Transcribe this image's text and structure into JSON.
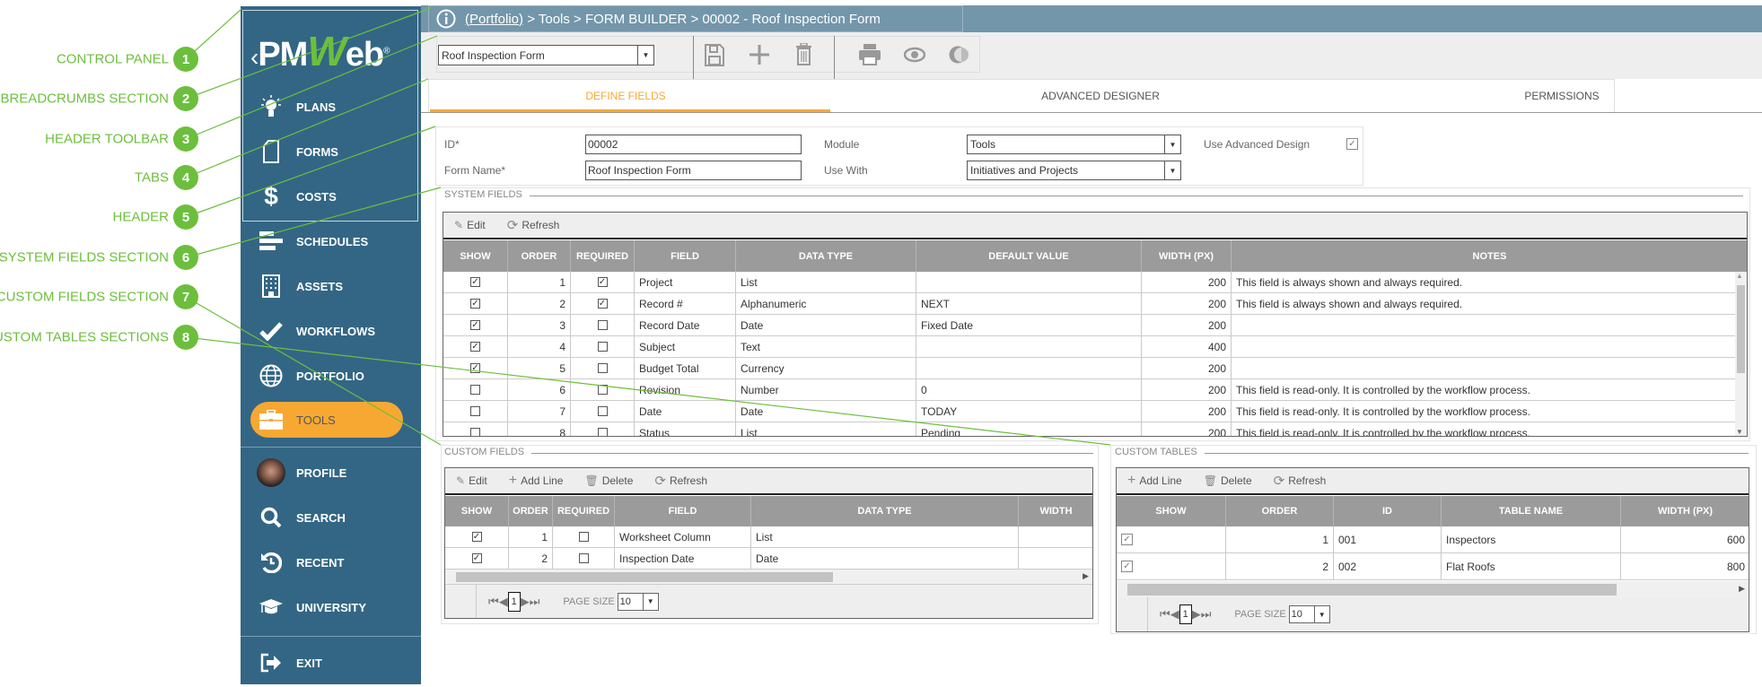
{
  "annotations": [
    {
      "n": "1",
      "label": "CONTROL PANEL"
    },
    {
      "n": "2",
      "label": "BREADCRUMBS SECTION"
    },
    {
      "n": "3",
      "label": "HEADER TOOLBAR"
    },
    {
      "n": "4",
      "label": "TABS"
    },
    {
      "n": "5",
      "label": "HEADER"
    },
    {
      "n": "6",
      "label": "SYSTEM FIELDS SECTION"
    },
    {
      "n": "7",
      "label": "CUSTOM FIELDS SECTION"
    },
    {
      "n": "8",
      "label": "CUSTOM TABLES SECTIONS"
    }
  ],
  "colors": {
    "sidebar": "#336685",
    "breadcrumb": "#7396ab",
    "accent": "#f7a833",
    "annotation": "#6cbf3c",
    "grid_header": "#9b9b9b"
  },
  "sidebar": {
    "logo": {
      "pre": "PM",
      "w": "W",
      "post": "eb",
      "reg": "®",
      "back": "‹"
    },
    "items": [
      {
        "label": "PLANS",
        "icon": "lightbulb-icon"
      },
      {
        "label": "FORMS",
        "icon": "document-icon"
      },
      {
        "label": "COSTS",
        "icon": "dollar-icon"
      },
      {
        "label": "SCHEDULES",
        "icon": "gantt-icon"
      },
      {
        "label": "ASSETS",
        "icon": "building-icon"
      },
      {
        "label": "WORKFLOWS",
        "icon": "checkmark-icon"
      },
      {
        "label": "PORTFOLIO",
        "icon": "globe-icon"
      },
      {
        "label": "TOOLS",
        "icon": "briefcase-icon",
        "active": true
      },
      {
        "label": "PROFILE",
        "icon": "avatar"
      },
      {
        "label": "SEARCH",
        "icon": "search-icon"
      },
      {
        "label": "RECENT",
        "icon": "history-icon"
      },
      {
        "label": "UNIVERSITY",
        "icon": "graduation-cap-icon"
      },
      {
        "label": "EXIT",
        "icon": "exit-icon"
      }
    ]
  },
  "breadcrumb": {
    "link": "(Portfolio)",
    "rest": " > Tools > FORM BUILDER > 00002 - Roof Inspection Form"
  },
  "toolbar": {
    "record_select": "Roof Inspection Form",
    "icons": [
      "save-icon",
      "add-icon",
      "delete-icon",
      "print-icon",
      "preview-icon",
      "toggle-icon"
    ]
  },
  "tabs": [
    {
      "label": "DEFINE FIELDS",
      "active": true
    },
    {
      "label": "ADVANCED DESIGNER"
    },
    {
      "label": "PERMISSIONS"
    }
  ],
  "header": {
    "id_label": "ID*",
    "id_value": "00002",
    "name_label": "Form Name*",
    "name_value": "Roof Inspection Form",
    "module_label": "Module",
    "module_value": "Tools",
    "usewith_label": "Use With",
    "usewith_value": "Initiatives and Projects",
    "advanced_label": "Use Advanced Design",
    "advanced_checked": true
  },
  "system_fields": {
    "title": "SYSTEM FIELDS",
    "toolbar": [
      "Edit",
      "Refresh"
    ],
    "columns": [
      "SHOW",
      "ORDER",
      "REQUIRED",
      "FIELD",
      "DATA TYPE",
      "DEFAULT VALUE",
      "WIDTH (PX)",
      "NOTES"
    ],
    "rows": [
      {
        "show": true,
        "order": "1",
        "required": true,
        "field": "Project",
        "type": "List",
        "default": "",
        "width": "200",
        "notes": "This field is always shown and always required."
      },
      {
        "show": true,
        "order": "2",
        "required": true,
        "field": "Record #",
        "type": "Alphanumeric",
        "default": "NEXT",
        "width": "200",
        "notes": "This field is always shown and always required."
      },
      {
        "show": true,
        "order": "3",
        "required": false,
        "field": "Record Date",
        "type": "Date",
        "default": "Fixed Date",
        "width": "200",
        "notes": ""
      },
      {
        "show": true,
        "order": "4",
        "required": false,
        "field": "Subject",
        "type": "Text",
        "default": "",
        "width": "400",
        "notes": ""
      },
      {
        "show": true,
        "order": "5",
        "required": false,
        "field": "Budget Total",
        "type": "Currency",
        "default": "",
        "width": "200",
        "notes": ""
      },
      {
        "show": false,
        "order": "6",
        "required": false,
        "field": "Revision",
        "type": "Number",
        "default": "0",
        "width": "200",
        "notes": "This field is read-only. It is controlled by the workflow process."
      },
      {
        "show": false,
        "order": "7",
        "required": false,
        "field": "Date",
        "type": "Date",
        "default": "TODAY",
        "width": "200",
        "notes": "This field is read-only. It is controlled by the workflow process."
      },
      {
        "show": false,
        "order": "8",
        "required": false,
        "field": "Status",
        "type": "List",
        "default": "Pending",
        "width": "200",
        "notes": "This field is read-only. It is controlled by the workflow process."
      }
    ]
  },
  "custom_fields": {
    "title": "CUSTOM FIELDS",
    "toolbar": [
      "Edit",
      "Add Line",
      "Delete",
      "Refresh"
    ],
    "columns": [
      "SHOW",
      "ORDER",
      "REQUIRED",
      "FIELD",
      "DATA TYPE",
      "WIDTH"
    ],
    "rows": [
      {
        "show": true,
        "order": "1",
        "required": false,
        "field": "Worksheet Column",
        "type": "List"
      },
      {
        "show": true,
        "order": "2",
        "required": false,
        "field": "Inspection Date",
        "type": "Date"
      }
    ],
    "pager": {
      "page": "1",
      "page_size_label": "PAGE SIZE",
      "page_size": "10"
    }
  },
  "custom_tables": {
    "title": "CUSTOM TABLES",
    "toolbar": [
      "Add Line",
      "Delete",
      "Refresh"
    ],
    "columns": [
      "SHOW",
      "ORDER",
      "ID",
      "TABLE NAME",
      "WIDTH (PX)"
    ],
    "rows": [
      {
        "show": true,
        "order": "1",
        "id": "001",
        "name": "Inspectors",
        "width": "600"
      },
      {
        "show": true,
        "order": "2",
        "id": "002",
        "name": "Flat Roofs",
        "width": "800"
      }
    ],
    "pager": {
      "page": "1",
      "page_size_label": "PAGE SIZE",
      "page_size": "10"
    }
  }
}
